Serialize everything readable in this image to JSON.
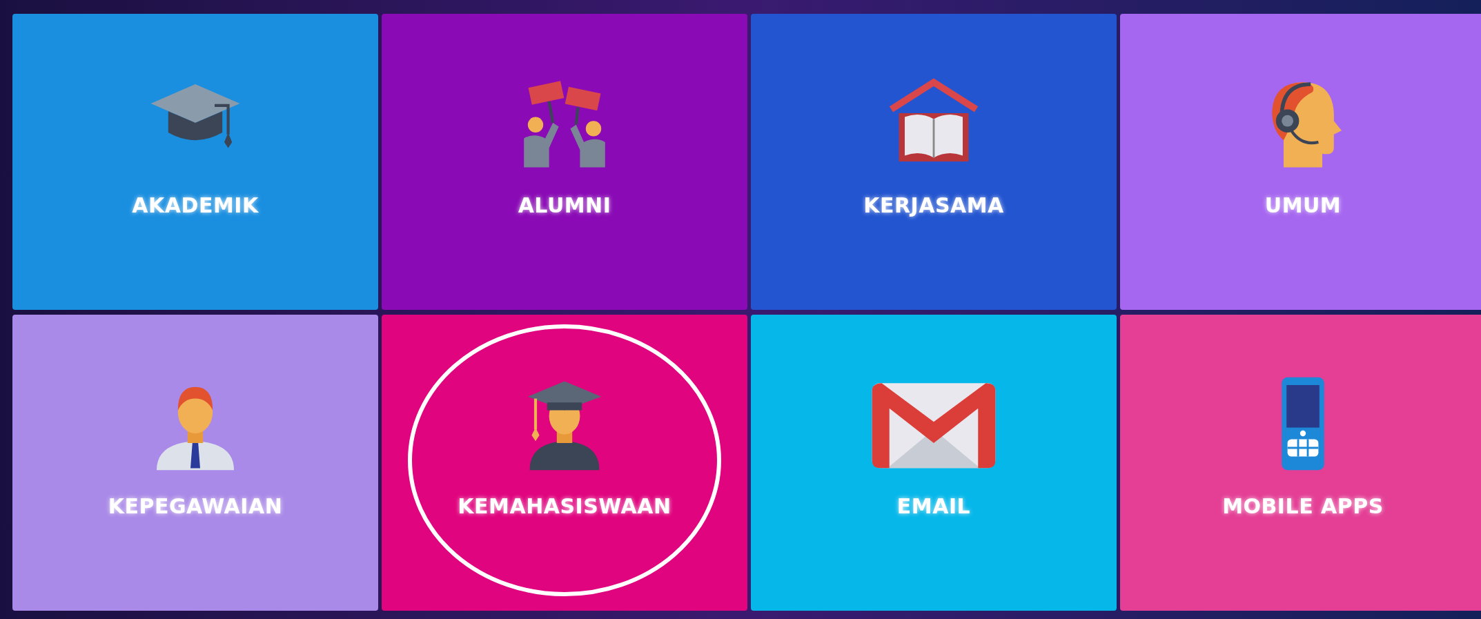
{
  "tiles": [
    {
      "label": "AKADEMIK",
      "color": "#1a8fe0",
      "circled": false
    },
    {
      "label": "ALUMNI",
      "color": "#8a0bb5",
      "circled": false
    },
    {
      "label": "KERJASAMA",
      "color": "#2355d0",
      "circled": false
    },
    {
      "label": "UMUM",
      "color": "#a667f0",
      "circled": false
    },
    {
      "label": "KEPEGAWAIAN",
      "color": "#aa8ae8",
      "circled": false
    },
    {
      "label": "KEMAHASISWAAN",
      "color": "#e0047e",
      "circled": true
    },
    {
      "label": "EMAIL",
      "color": "#06b8ea",
      "circled": false
    },
    {
      "label": "MOBILE APPS",
      "color": "#e43f95",
      "circled": false
    }
  ]
}
